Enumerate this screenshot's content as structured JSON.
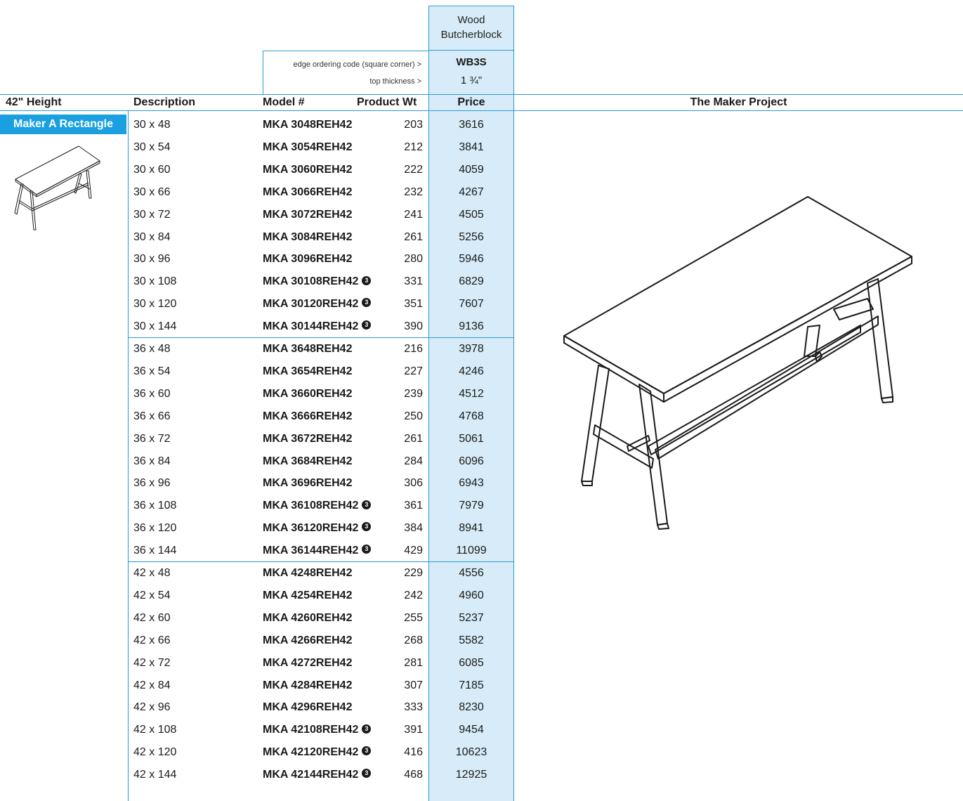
{
  "finish": {
    "name_line1": "Wood",
    "name_line2": "Butcherblock",
    "edge_code_label": "edge ordering code (square corner) >",
    "thickness_label": "top thickness >",
    "edge_code": "WB3S",
    "thickness": "1 ¾\""
  },
  "header": {
    "height": "42\" Height",
    "description": "Description",
    "model": "Model #",
    "weight": "Product Wt",
    "price": "Price",
    "series": "The Maker Project"
  },
  "product": {
    "name": "Maker A Rectangle"
  },
  "note_symbol": "3",
  "rows": [
    {
      "desc": "30 x 48",
      "model": "MKA 3048REH42",
      "wt": "203",
      "price": "3616",
      "note": false
    },
    {
      "desc": "30 x 54",
      "model": "MKA 3054REH42",
      "wt": "212",
      "price": "3841",
      "note": false
    },
    {
      "desc": "30 x 60",
      "model": "MKA 3060REH42",
      "wt": "222",
      "price": "4059",
      "note": false
    },
    {
      "desc": "30 x 66",
      "model": "MKA 3066REH42",
      "wt": "232",
      "price": "4267",
      "note": false
    },
    {
      "desc": "30 x 72",
      "model": "MKA 3072REH42",
      "wt": "241",
      "price": "4505",
      "note": false
    },
    {
      "desc": "30 x 84",
      "model": "MKA 3084REH42",
      "wt": "261",
      "price": "5256",
      "note": false
    },
    {
      "desc": "30 x 96",
      "model": "MKA 3096REH42",
      "wt": "280",
      "price": "5946",
      "note": false
    },
    {
      "desc": "30 x 108",
      "model": "MKA 30108REH42",
      "wt": "331",
      "price": "6829",
      "note": true
    },
    {
      "desc": "30 x 120",
      "model": "MKA 30120REH42",
      "wt": "351",
      "price": "7607",
      "note": true
    },
    {
      "desc": "30 x 144",
      "model": "MKA 30144REH42",
      "wt": "390",
      "price": "9136",
      "note": true
    },
    {
      "desc": "36 x 48",
      "model": "MKA 3648REH42",
      "wt": "216",
      "price": "3978",
      "note": false
    },
    {
      "desc": "36 x 54",
      "model": "MKA 3654REH42",
      "wt": "227",
      "price": "4246",
      "note": false
    },
    {
      "desc": "36 x 60",
      "model": "MKA 3660REH42",
      "wt": "239",
      "price": "4512",
      "note": false
    },
    {
      "desc": "36 x 66",
      "model": "MKA 3666REH42",
      "wt": "250",
      "price": "4768",
      "note": false
    },
    {
      "desc": "36 x 72",
      "model": "MKA 3672REH42",
      "wt": "261",
      "price": "5061",
      "note": false
    },
    {
      "desc": "36 x 84",
      "model": "MKA 3684REH42",
      "wt": "284",
      "price": "6096",
      "note": false
    },
    {
      "desc": "36 x 96",
      "model": "MKA 3696REH42",
      "wt": "306",
      "price": "6943",
      "note": false
    },
    {
      "desc": "36 x 108",
      "model": "MKA 36108REH42",
      "wt": "361",
      "price": "7979",
      "note": true
    },
    {
      "desc": "36 x 120",
      "model": "MKA 36120REH42",
      "wt": "384",
      "price": "8941",
      "note": true
    },
    {
      "desc": "36 x 144",
      "model": "MKA 36144REH42",
      "wt": "429",
      "price": "11099",
      "note": true
    },
    {
      "desc": "42 x 48",
      "model": "MKA 4248REH42",
      "wt": "229",
      "price": "4556",
      "note": false
    },
    {
      "desc": "42 x 54",
      "model": "MKA 4254REH42",
      "wt": "242",
      "price": "4960",
      "note": false
    },
    {
      "desc": "42 x 60",
      "model": "MKA 4260REH42",
      "wt": "255",
      "price": "5237",
      "note": false
    },
    {
      "desc": "42 x 66",
      "model": "MKA 4266REH42",
      "wt": "268",
      "price": "5582",
      "note": false
    },
    {
      "desc": "42 x 72",
      "model": "MKA 4272REH42",
      "wt": "281",
      "price": "6085",
      "note": false
    },
    {
      "desc": "42 x 84",
      "model": "MKA 4284REH42",
      "wt": "307",
      "price": "7185",
      "note": false
    },
    {
      "desc": "42 x 96",
      "model": "MKA 4296REH42",
      "wt": "333",
      "price": "8230",
      "note": false
    },
    {
      "desc": "42 x 108",
      "model": "MKA 42108REH42",
      "wt": "391",
      "price": "9454",
      "note": true
    },
    {
      "desc": "42 x 120",
      "model": "MKA 42120REH42",
      "wt": "416",
      "price": "10623",
      "note": true
    },
    {
      "desc": "42 x 144",
      "model": "MKA 42144REH42",
      "wt": "468",
      "price": "12925",
      "note": true
    }
  ]
}
